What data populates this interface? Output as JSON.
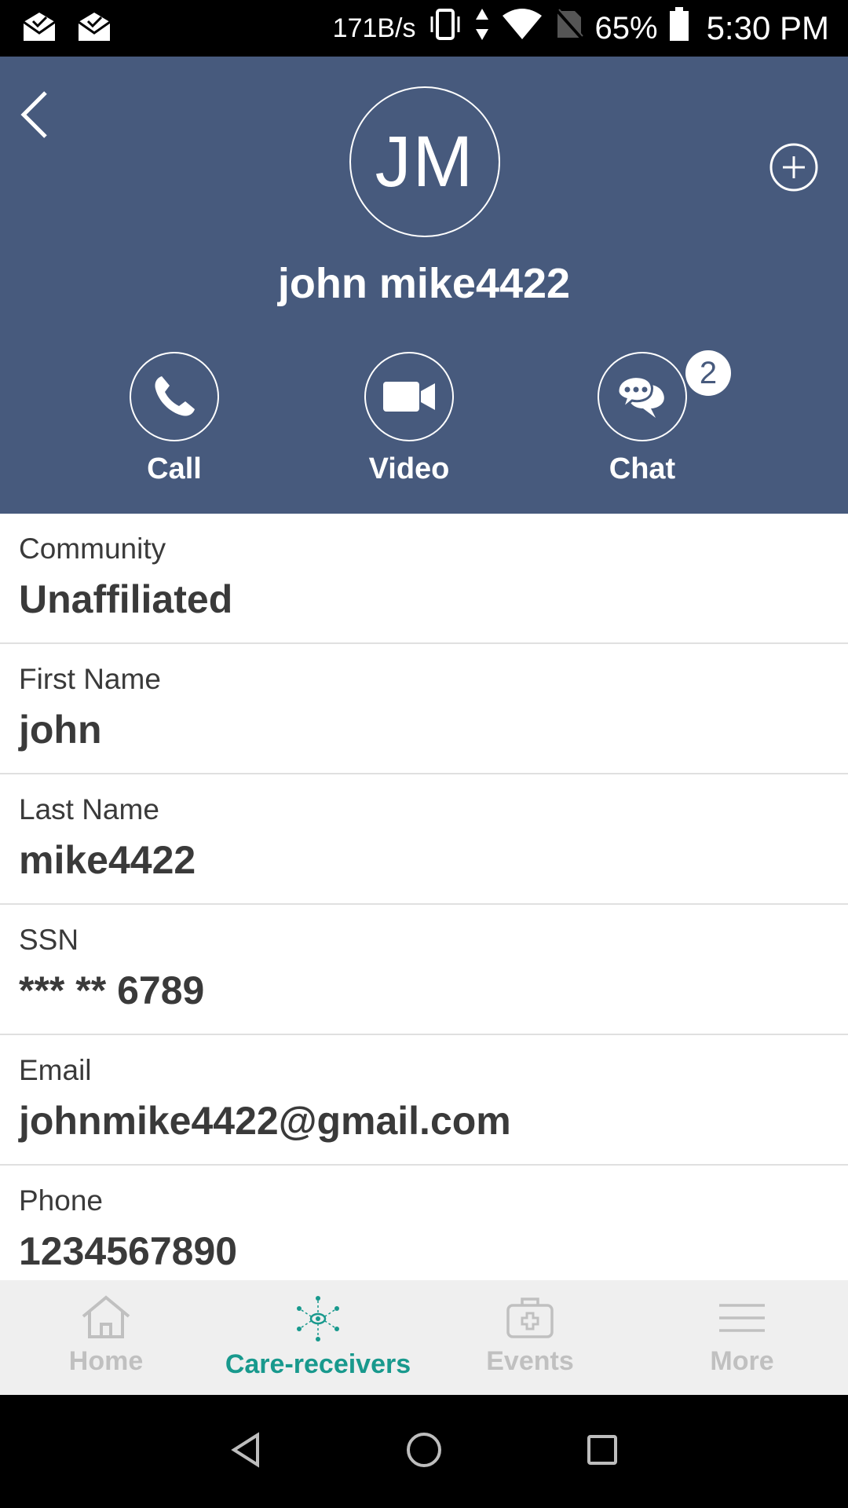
{
  "status_bar": {
    "net_speed": "171B/s",
    "battery": "65%",
    "time": "5:30 PM",
    "icons": [
      "mail-check-icon",
      "mail-check-icon",
      "vibrate-icon",
      "data-arrows-icon",
      "wifi-icon",
      "no-sim-icon",
      "battery-icon"
    ]
  },
  "header": {
    "initials": "JM",
    "name": "john mike4422",
    "actions": [
      {
        "label": "Call",
        "icon": "phone-icon"
      },
      {
        "label": "Video",
        "icon": "video-camera-icon"
      },
      {
        "label": "Chat",
        "icon": "chat-bubbles-icon",
        "badge": "2"
      }
    ],
    "colors": {
      "background": "#475a7d"
    }
  },
  "fields": [
    {
      "label": "Community",
      "value": "Unaffiliated"
    },
    {
      "label": "First Name",
      "value": "john"
    },
    {
      "label": "Last Name",
      "value": "mike4422"
    },
    {
      "label": "SSN",
      "value": "*** ** 6789"
    },
    {
      "label": "Email",
      "value": "johnmike4422@gmail.com"
    },
    {
      "label": "Phone",
      "value": "1234567890"
    }
  ],
  "tabs": [
    {
      "label": "Home",
      "icon": "home-icon",
      "active": false
    },
    {
      "label": "Care-receivers",
      "icon": "care-network-icon",
      "active": true
    },
    {
      "label": "Events",
      "icon": "medical-kit-icon",
      "active": false
    },
    {
      "label": "More",
      "icon": "menu-icon",
      "active": false
    }
  ],
  "theme": {
    "accent": "#18998d",
    "inactive": "#c0c0c0"
  }
}
